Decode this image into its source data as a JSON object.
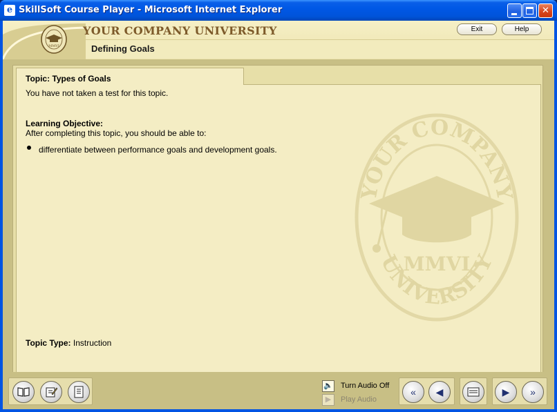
{
  "window": {
    "title": "SkillSoft Course Player - Microsoft Internet Explorer",
    "controls": [
      "minimize",
      "maximize",
      "close"
    ]
  },
  "header": {
    "company_name": "YOUR COMPANY UNIVERSITY",
    "course_title": "Defining Goals",
    "exit_label": "Exit",
    "help_label": "Help",
    "logo": {
      "top_text": "YOUR COMPANY",
      "middle_text": "MMVI",
      "bottom_text": "UNIVERSITY"
    }
  },
  "content": {
    "topic_label": "Topic: Types of Goals",
    "test_status": "You have not taken a test for this topic.",
    "learning_objective_heading": "Learning Objective:",
    "learning_objective_intro": "After completing this topic, you should be able to:",
    "objectives": [
      "differentiate between performance goals and development goals."
    ],
    "topic_type_label": "Topic Type:",
    "topic_type_value": "Instruction",
    "watermark": {
      "top_text": "YOUR COMPANY",
      "middle_text": "MMVI",
      "bottom_text": "UNIVERSITY"
    }
  },
  "footer": {
    "left_buttons": [
      {
        "name": "book-icon"
      },
      {
        "name": "notepad-icon"
      },
      {
        "name": "document-icon"
      }
    ],
    "audio": {
      "turn_off_label": "Turn Audio Off",
      "play_label": "Play Audio",
      "speaker_icon": "speaker-icon",
      "play_icon": "play-icon"
    },
    "nav_buttons": [
      {
        "name": "rewind-icon"
      },
      {
        "name": "back-icon"
      },
      {
        "name": "menu-icon"
      },
      {
        "name": "forward-icon"
      },
      {
        "name": "fast-forward-icon"
      }
    ]
  },
  "colors": {
    "background": "#c8bf85",
    "panel": "#f4edc4",
    "brand": "#7d5a2a",
    "titlebar": "#0058e6"
  }
}
